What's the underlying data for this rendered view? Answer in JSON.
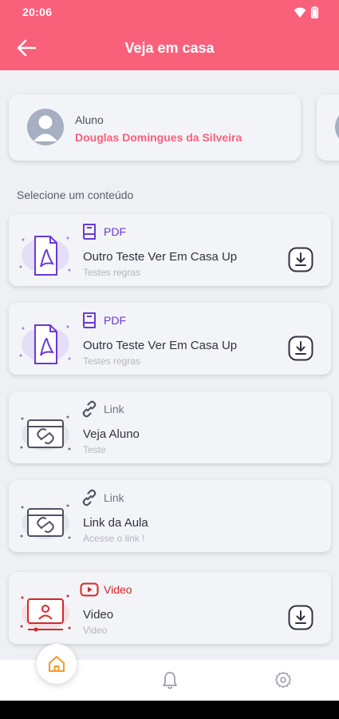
{
  "status_bar": {
    "time": "20:06"
  },
  "app_bar": {
    "title": "Veja em casa"
  },
  "student": {
    "label": "Aluno",
    "name": "Douglas Domingues da Silveira"
  },
  "section_title": "Selecione um conteúdo",
  "items": [
    {
      "type": "PDF",
      "title": "Outro Teste Ver Em Casa Up",
      "subtitle": "Testes regras",
      "downloadable": true
    },
    {
      "type": "PDF",
      "title": "Outro Teste Ver Em Casa Up",
      "subtitle": "Testes regras",
      "downloadable": true
    },
    {
      "type": "Link",
      "title": "Veja Aluno",
      "subtitle": "Teste",
      "downloadable": false
    },
    {
      "type": "Link",
      "title": "Link da Aula",
      "subtitle": "Acesse o link !",
      "downloadable": false
    },
    {
      "type": "Video",
      "title": "Video",
      "subtitle": "Video",
      "downloadable": true
    }
  ],
  "bottom_nav": [
    {
      "icon": "home-icon",
      "active": true
    },
    {
      "icon": "bell-icon",
      "active": false
    },
    {
      "icon": "gear-icon",
      "active": false
    }
  ],
  "colors": {
    "brand": "#f9617b",
    "background": "#eef0f4",
    "pdf": "#6a3ad6",
    "link": "#6f7384",
    "video": "#d7262b",
    "home_active": "#f39a2d"
  }
}
